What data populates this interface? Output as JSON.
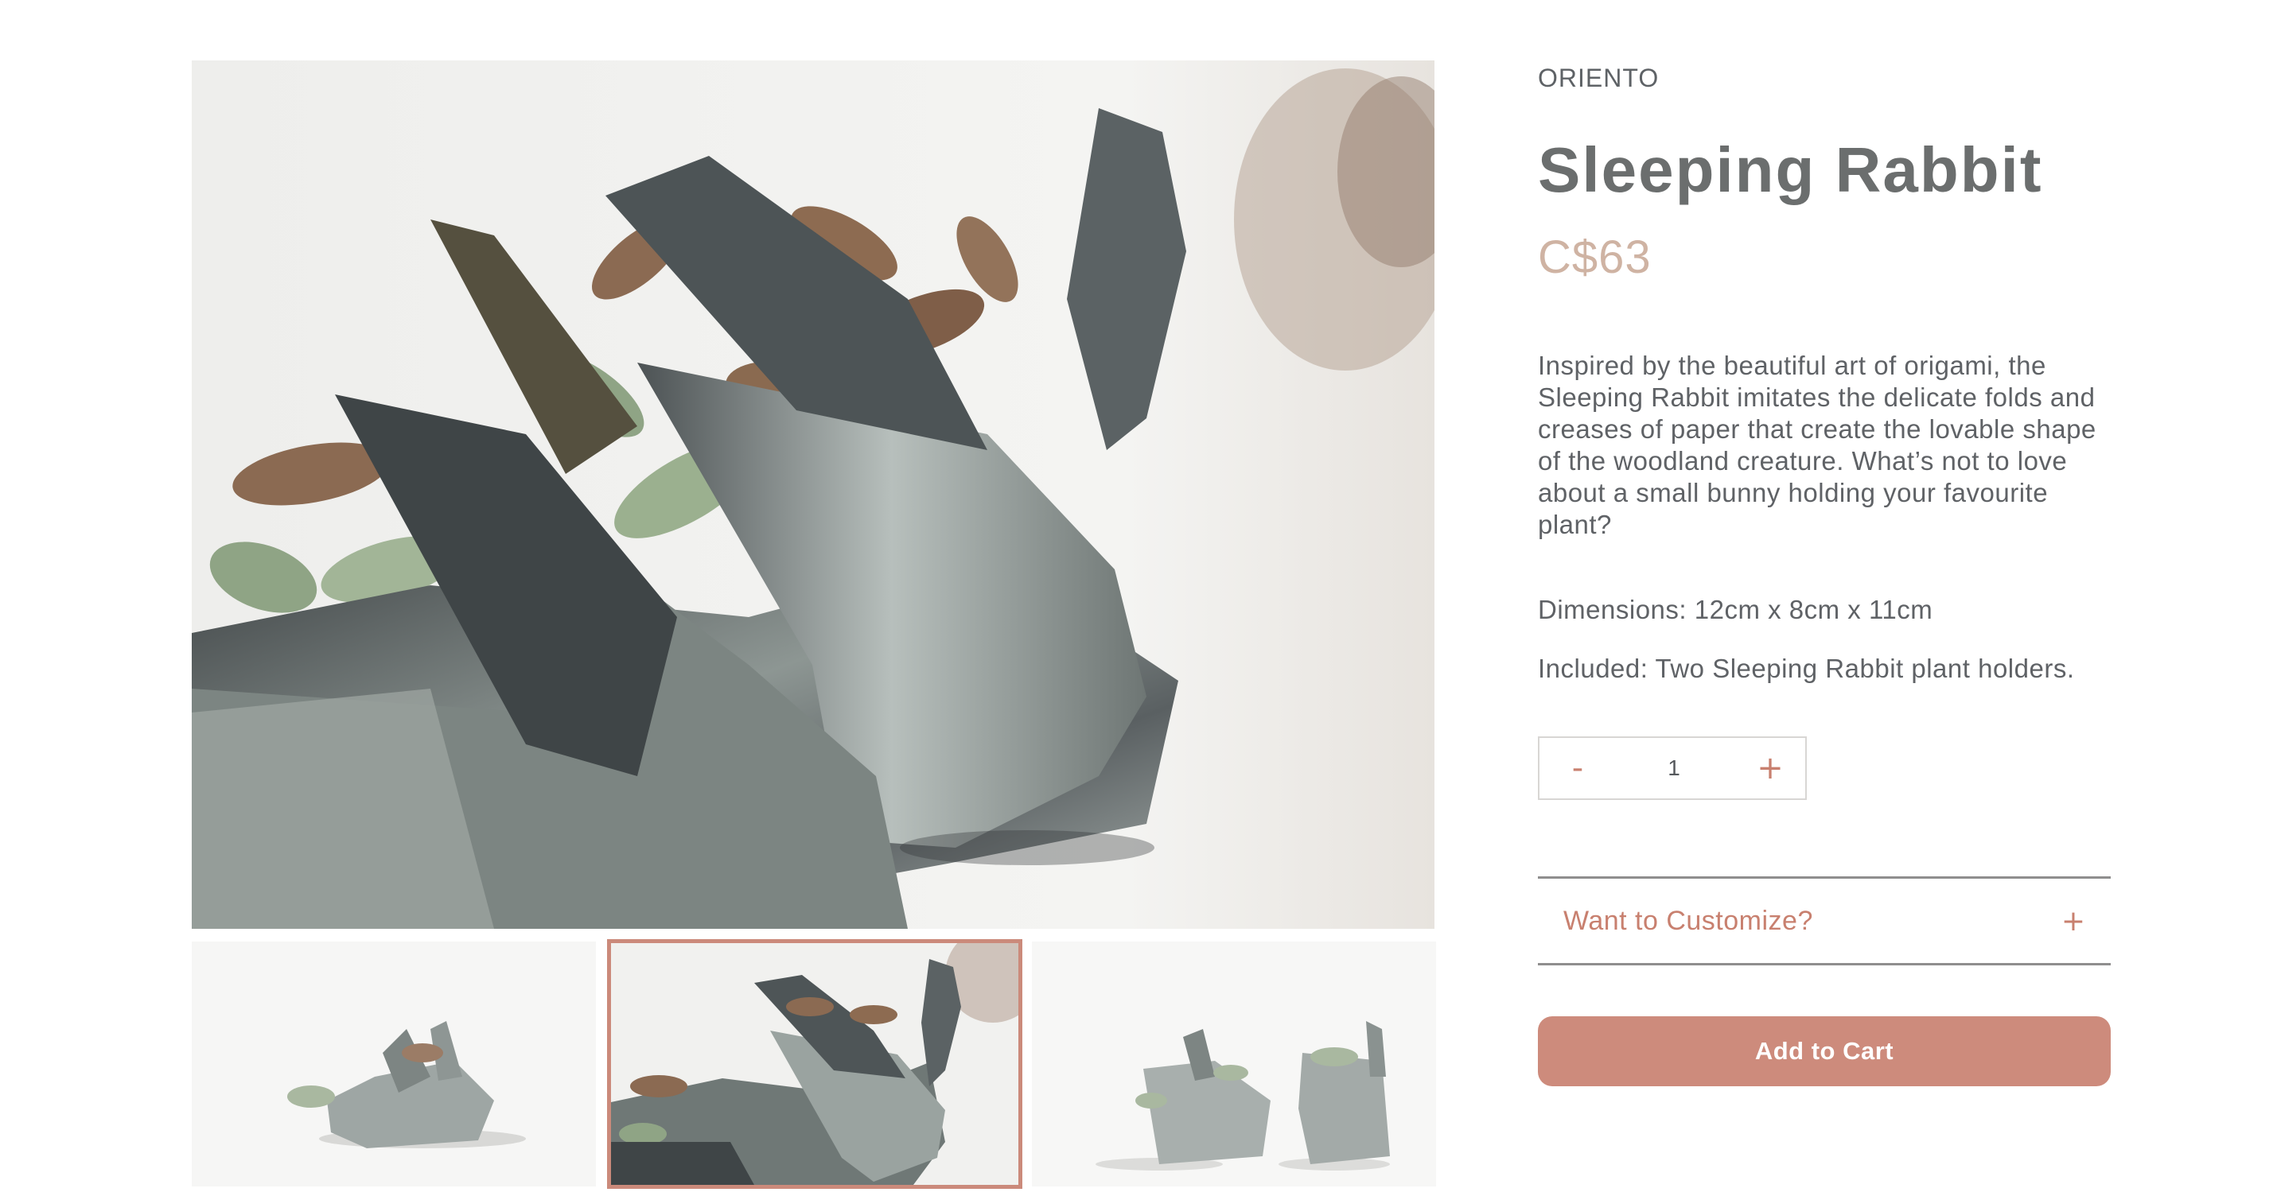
{
  "product": {
    "vendor": "ORIENTO",
    "title": "Sleeping Rabbit",
    "price": "C$63",
    "description": "Inspired by the beautiful art of origami, the Sleeping Rabbit imitates the delicate folds and creases of paper that create the lovable shape of the woodland creature. What’s not to love about a small bunny holding your favourite plant?",
    "dimensions": "Dimensions: 12cm x 8cm x 11cm",
    "included": "Included: Two Sleeping Rabbit plant holders."
  },
  "quantity": {
    "decrement_label": "-",
    "value": "1",
    "increment_label": "+"
  },
  "customize": {
    "label": "Want to Customize?",
    "toggle_icon": "+"
  },
  "cart": {
    "button_label": "Add to Cart"
  },
  "gallery": {
    "selected_thumbnail": 2,
    "thumbnail_count": 3
  },
  "colors": {
    "accent": "#cd8b7c",
    "price": "#cfb3a3",
    "title": "#6b6e6e"
  }
}
